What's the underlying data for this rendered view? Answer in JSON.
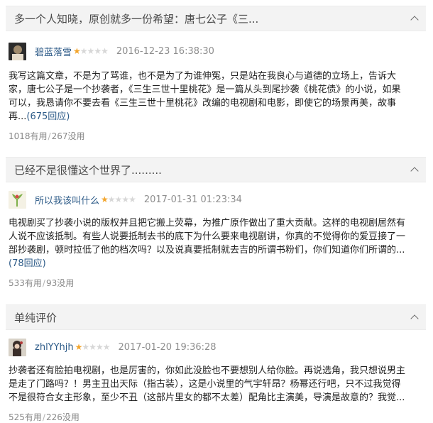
{
  "reviews": [
    {
      "title": "多一个人知晓，原创就多一份希望：唐七公子《三...",
      "username": "碧蓝落雪",
      "rating": 1,
      "max_rating": 5,
      "timestamp": "2016-12-23 16:38:30",
      "body": "我写这篇文章，不是为了骂谁，也不是为了为谁伸冤，只是站在我良心与道德的立场上，告诉大家，唐七公子是一个抄袭者，《三生三世十里桃花》是一篇从头到尾抄袭《桃花债》的小说，如果可以，我恳请你不要去看《三生三世十里桃花》改编的电视剧和电影，即使它的场景再美，故事再...",
      "replies": "(675回应)",
      "useful": "1018有用",
      "useless": "267没用",
      "avatar_colors": [
        "#2b2b2b",
        "#9f8a6c",
        "#e6dccb"
      ]
    },
    {
      "title": "已经不是很懂这个世界了.........",
      "username": "所以我该叫什么",
      "rating": 1,
      "max_rating": 5,
      "timestamp": "2017-01-31 01:23:34",
      "body": "电视剧买了抄袭小说的版权并且把它搬上荧幕，为推广原作做出了重大贡献。这样的电视剧居然有人说不应该抵制。有些人说要抵制去书的底下为什么要来电视剧讲，你真的不觉得你的爱豆接了一部抄袭剧，顿时拉低了他的档次吗？以及说真要抵制就去吉的所谓书粉们，你们知道你们所谓的...",
      "replies": "(78回应)",
      "useful": "533有用",
      "useless": "93没用",
      "avatar_colors": [
        "#f4f1e4",
        "#7fb04a",
        "#d74a4a"
      ]
    },
    {
      "title": "单纯评价",
      "username": "zhlYYhjh",
      "rating": 1,
      "max_rating": 5,
      "timestamp": "2017-01-20 19:36:28",
      "body": "抄袭者还有脸拍电视剧，也是厉害的，你如此没脸也不要想别人给你脸。再说选角，我只想说男主是走了门路吗？！男主丑出天际（指古装），这是小说里的气宇轩昂？杨幂还行吧，只不过我觉得不是很符合女主形象，至少不丑（这部片里女的都不太差）配角比主演美，导演是故意的？我觉...",
      "replies": "",
      "useful": "525有用",
      "useless": "226没用",
      "avatar_colors": [
        "#d8d2c8",
        "#3a2e2a",
        "#b23a3a"
      ]
    }
  ],
  "vote_separator": "/",
  "star_glyph": "★"
}
